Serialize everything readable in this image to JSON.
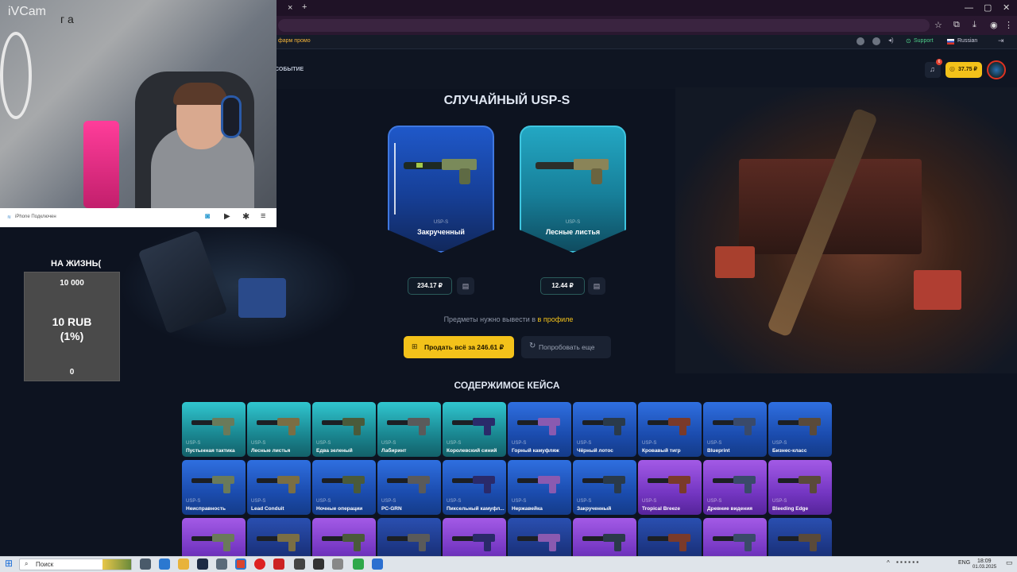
{
  "browser": {
    "tab_close": "×",
    "new_tab": "+"
  },
  "site": {
    "promo_text": "фарм промо",
    "support_label": "Support",
    "language_label": "Russian",
    "event_label": "СОБЫТИЕ",
    "notification_count": "6",
    "balance": "37.75 ₽"
  },
  "webcam": {
    "app_name": "iVCam",
    "status": "iPhone Подключен",
    "wall_chars": "г а"
  },
  "donation": {
    "title": "НА ЖИЗНЬ(",
    "goal": "10 000",
    "amount": "10 RUB",
    "percent": "(1%)",
    "current": "0"
  },
  "main": {
    "title": "СЛУЧАЙНЫЙ USP-S",
    "cards": [
      {
        "weapon": "USP-S",
        "skin": "Закрученный",
        "price": "234.17 ₽",
        "accent": "#1f58c9"
      },
      {
        "weapon": "USP-S",
        "skin": "Лесные листья",
        "price": "12.44 ₽",
        "accent": "#23a7c3"
      }
    ],
    "withdraw_note": "Предметы нужно вывести в",
    "withdraw_link": "в профиле",
    "sell_all_label": "Продать всё за 246.61 ₽",
    "try_again_label": "Попробовать еще",
    "contents_title": "СОДЕРЖИМОЕ КЕЙСА"
  },
  "case_items_row1": [
    {
      "weapon": "USP-S",
      "skin": "Пустынная тактика",
      "rarity": "teal"
    },
    {
      "weapon": "USP-S",
      "skin": "Лесные листья",
      "rarity": "teal"
    },
    {
      "weapon": "USP-S",
      "skin": "Едва зеленый",
      "rarity": "teal"
    },
    {
      "weapon": "USP-S",
      "skin": "Лабиринт",
      "rarity": "teal"
    },
    {
      "weapon": "USP-S",
      "skin": "Королевский синий",
      "rarity": "teal"
    },
    {
      "weapon": "USP-S",
      "skin": "Горный камуфляж",
      "rarity": "blue"
    },
    {
      "weapon": "USP-S",
      "skin": "Чёрный лотос",
      "rarity": "blue"
    },
    {
      "weapon": "USP-S",
      "skin": "Кровавый тигр",
      "rarity": "blue"
    },
    {
      "weapon": "USP-S",
      "skin": "Blueprint",
      "rarity": "blue"
    },
    {
      "weapon": "USP-S",
      "skin": "Бизнес-класс",
      "rarity": "blue"
    }
  ],
  "case_items_row2": [
    {
      "weapon": "USP-S",
      "skin": "Неисправность",
      "rarity": "blue"
    },
    {
      "weapon": "USP-S",
      "skin": "Lead Conduit",
      "rarity": "blue"
    },
    {
      "weapon": "USP-S",
      "skin": "Ночные операции",
      "rarity": "blue"
    },
    {
      "weapon": "USP-S",
      "skin": "PC-GRN",
      "rarity": "blue"
    },
    {
      "weapon": "USP-S",
      "skin": "Пиксельный камуфл...",
      "rarity": "blue"
    },
    {
      "weapon": "USP-S",
      "skin": "Нержавейка",
      "rarity": "blue"
    },
    {
      "weapon": "USP-S",
      "skin": "Закрученный",
      "rarity": "blue"
    },
    {
      "weapon": "USP-S",
      "skin": "Tropical Breeze",
      "rarity": "purple"
    },
    {
      "weapon": "USP-S",
      "skin": "Древние видения",
      "rarity": "purple"
    },
    {
      "weapon": "USP-S",
      "skin": "Bleeding Edge",
      "rarity": "purple"
    }
  ],
  "taskbar": {
    "search_placeholder": "Поиск",
    "lang": "ENG",
    "time": "18:09",
    "date": "01.03.2025"
  }
}
